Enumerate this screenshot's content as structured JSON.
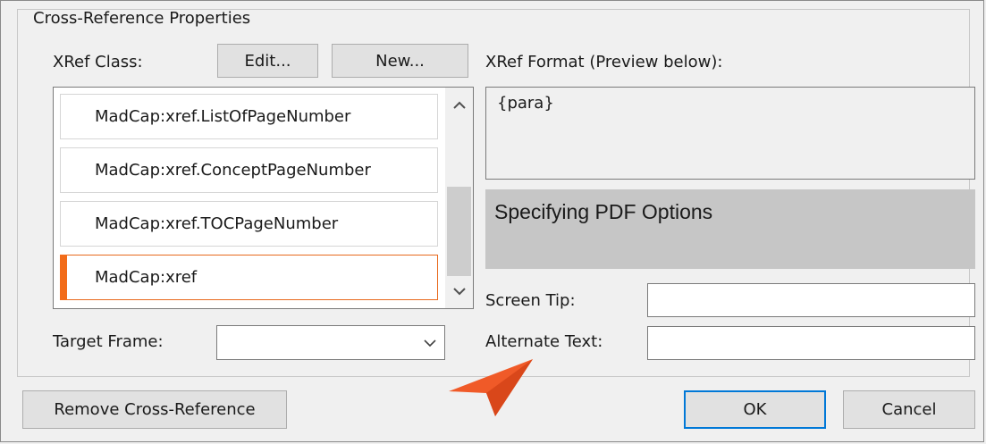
{
  "group": {
    "legend": "Cross-Reference Properties"
  },
  "xref_class": {
    "label": "XRef Class:",
    "edit_label": "Edit...",
    "new_label": "New...",
    "items": [
      "MadCap:xref.ListOfPageNumber",
      "MadCap:xref.ConceptPageNumber",
      "MadCap:xref.TOCPageNumber",
      "MadCap:xref"
    ],
    "selected_item": "MadCap:xref"
  },
  "target_frame": {
    "label": "Target Frame:",
    "value": ""
  },
  "xref_format": {
    "label": "XRef Format (Preview below):",
    "value": "{para}",
    "preview": "Specifying PDF Options"
  },
  "screen_tip": {
    "label": "Screen Tip:",
    "value": ""
  },
  "alternate_text": {
    "label": "Alternate Text:",
    "value": ""
  },
  "buttons": {
    "remove": "Remove Cross-Reference",
    "ok": "OK",
    "cancel": "Cancel"
  },
  "icons": {
    "scroll_up": "chevron-up-icon",
    "scroll_down": "chevron-down-icon",
    "combo": "chevron-down-icon",
    "pointer": "pointer-arrow-icon"
  },
  "colors": {
    "selection_accent": "#f26c1a",
    "default_button_border": "#0078d7",
    "preview_background": "#c6c6c6",
    "pointer": "#f05a28"
  }
}
